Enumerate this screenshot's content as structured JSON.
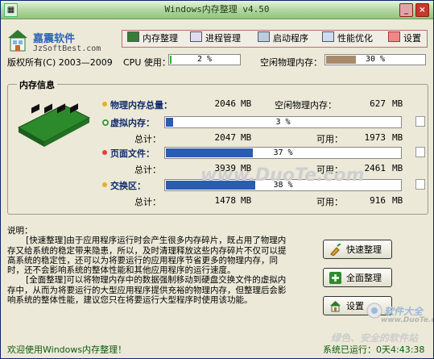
{
  "window": {
    "title": "Windows内存整理 v4.50"
  },
  "logo": {
    "name": "嘉震软件",
    "url": "JzSoftBest.com"
  },
  "copyright": "版权所有(C) 2003—2009",
  "nav": [
    "内存整理",
    "进程管理",
    "启动程序",
    "性能优化",
    "设置"
  ],
  "cpu": {
    "label": "CPU 使用：",
    "value": 2,
    "value_text": "2 %"
  },
  "free_mem": {
    "label": "空闲物理内存：",
    "value": 30,
    "value_text": "30 %"
  },
  "panel": {
    "title": "内存信息",
    "physical": {
      "label": "物理内存总量：",
      "total": "2046",
      "unit": "MB",
      "free_label": "空闲物理内存：",
      "free": "627"
    },
    "virtual": {
      "label": "虚拟内存：",
      "percent": 3,
      "percent_text": "3 %",
      "total_label": "总计：",
      "total": "2047",
      "unit": "MB",
      "avail_label": "可用：",
      "avail": "1973"
    },
    "pagefile": {
      "label": "页面文件：",
      "percent": 37,
      "percent_text": "37 %",
      "total_label": "总计：",
      "total": "3939",
      "unit": "MB",
      "avail_label": "可用：",
      "avail": "2461"
    },
    "swap": {
      "label": "交换区：",
      "percent": 38,
      "percent_text": "38 %",
      "total_label": "总计：",
      "total": "1478",
      "unit": "MB",
      "avail_label": "可用：",
      "avail": "916"
    }
  },
  "description": {
    "heading": "说明：",
    "p1": "[快速整理]由于应用程序运行时会产生很多内存碎片，既占用了物理内存又给系统的稳定带来隐患，所以，及时清理释放这些内存碎片不仅可以提高系统的稳定性，还可以为将要运行的应用程序节省更多的物理内存，同时，还不会影响系统的整体性能和其他应用程序的运行速度。",
    "p2": "[全面整理]可以将物理内存中的数据强制移动到硬盘交换文件的虚拟内存中，从而为将要运行的大型应用程序提供充裕的物理内存，但整理后会影响系统的整体性能，建议您只在将要运行大型程序时使用该功能。"
  },
  "buttons": {
    "quick": "快速整理",
    "full": "全面整理",
    "settings": "设置"
  },
  "status": {
    "welcome": "欢迎使用Windows内存整理！",
    "uptime": "系统已运行：0天4:43:38"
  },
  "watermarks": {
    "center": "www.DuoTe.com",
    "logo_text": "软件大全",
    "logo_url": "www.DuoTe.com",
    "bottom": "绿色、安全的软件站"
  },
  "colors": {
    "progress_blue": "#2a5db0",
    "free_mem_fill": "#a88a6a",
    "cpu_fill": "#3aa83a",
    "status_green": "#0a5c0a"
  }
}
